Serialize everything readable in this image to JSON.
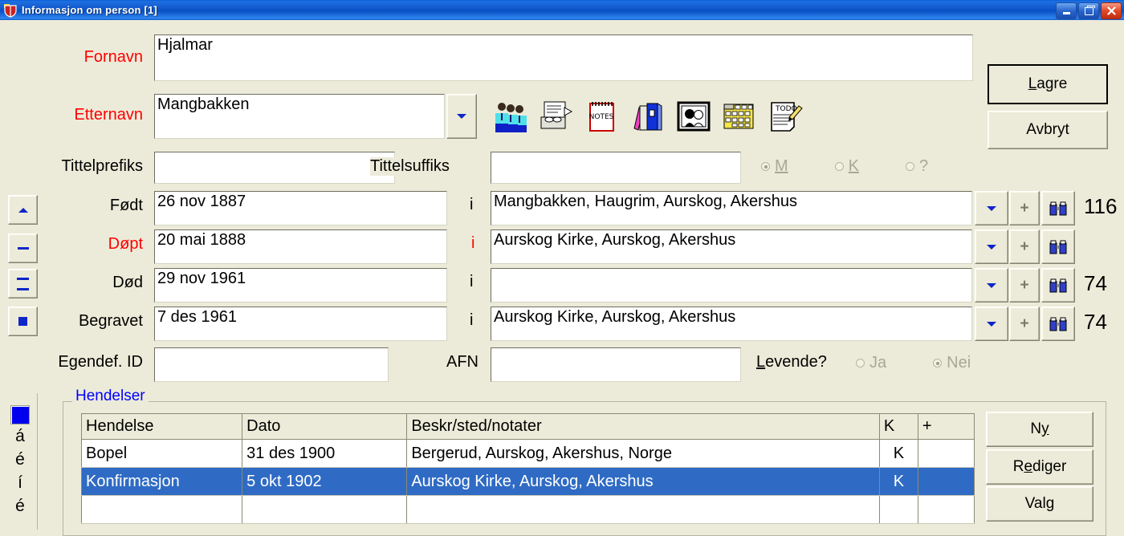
{
  "window": {
    "title": "Informasjon om person  [1]",
    "icon": "app-shield-icon",
    "minimize": "–",
    "restore": "❐",
    "close": "✕",
    "titlebar_color": "#0a4fc4",
    "background_color": "#ecebd9"
  },
  "form": {
    "fornavn": {
      "label": "Fornavn",
      "value": "Hjalmar",
      "label_color": "#ff0000"
    },
    "etternavn": {
      "label": "Etternavn",
      "value": "Mangbakken",
      "label_color": "#ff0000",
      "dropdown": "chevron-down-icon"
    },
    "tittelprefiks": {
      "label": "Tittelprefiks",
      "value": ""
    },
    "tittelsuffiks": {
      "label": "Tittelsuffiks",
      "value": ""
    },
    "egendef_id": {
      "label": "Egendef. ID",
      "value": ""
    },
    "afn": {
      "label": "AFN",
      "value": ""
    }
  },
  "gender": {
    "options": [
      {
        "label": "M",
        "accel": "M",
        "selected": true
      },
      {
        "label": "K",
        "accel": "K",
        "selected": false
      },
      {
        "label": "?",
        "accel": "",
        "selected": false
      }
    ],
    "disabled": true
  },
  "levende": {
    "label": "Levende?",
    "accel": "L",
    "options": [
      {
        "label": "Ja",
        "selected": false
      },
      {
        "label": "Nei",
        "selected": true
      }
    ],
    "disabled": true
  },
  "toolbar_icons": [
    "family-group-icon",
    "documents-icon",
    "notes-pad-icon",
    "books-icon",
    "photo-portrait-icon",
    "calendar-grid-icon",
    "todo-list-icon"
  ],
  "actions": {
    "save": {
      "label": "Lagre",
      "accel": "L",
      "default": true
    },
    "cancel": {
      "label": "Avbryt"
    }
  },
  "vital_side_buttons": [
    {
      "name": "move-up-button",
      "glyph": "▲"
    },
    {
      "name": "dash-button",
      "glyph": "–"
    },
    {
      "name": "equals-button",
      "glyph": "≡"
    },
    {
      "name": "square-button",
      "glyph": "■"
    }
  ],
  "vitals": [
    {
      "label": "Født",
      "label_color": "#000000",
      "date": "26 nov 1887",
      "info_mark": "i",
      "info_color": "#000000",
      "place": "Mangbakken, Haugrim, Aurskog, Akershus",
      "age": "116"
    },
    {
      "label": "Døpt",
      "label_color": "#ff0000",
      "date": "20 mai 1888",
      "info_mark": "i",
      "info_color": "#ff0000",
      "place": "Aurskog Kirke, Aurskog, Akershus",
      "age": ""
    },
    {
      "label": "Død",
      "label_color": "#000000",
      "date": "29 nov 1961",
      "info_mark": "i",
      "info_color": "#000000",
      "place": "",
      "age": "74"
    },
    {
      "label": "Begravet",
      "label_color": "#000000",
      "date": "7 des 1961",
      "info_mark": "i",
      "info_color": "#000000",
      "place": "Aurskog Kirke, Aurskog, Akershus",
      "age": "74"
    }
  ],
  "row_buttons": {
    "dropdown": "chevron-down-icon",
    "add": "+",
    "search": "binoculars-search-icon"
  },
  "events": {
    "group_title": "Hendelser",
    "columns": [
      "Hendelse",
      "Dato",
      "Beskr/sted/notater",
      "K",
      "+"
    ],
    "rows": [
      {
        "hendelse": "Bopel",
        "dato": "31 des 1900",
        "beskr": "Bergerud, Aurskog, Akershus, Norge",
        "k": "K",
        "plus": "",
        "selected": false
      },
      {
        "hendelse": "Konfirmasjon",
        "dato": "5 okt 1902",
        "beskr": "Aurskog Kirke, Aurskog, Akershus",
        "k": "K",
        "plus": "",
        "selected": true
      }
    ],
    "buttons": [
      {
        "label": "Ny",
        "accel": "y",
        "name": "new-event-button"
      },
      {
        "label": "Rediger",
        "accel": "e",
        "name": "edit-event-button"
      },
      {
        "label": "Valg",
        "accel": "g",
        "name": "options-event-button"
      }
    ],
    "selection_color": "#2f6bc4"
  },
  "accent_panel": {
    "swatch_color": "#0000ee",
    "chars": [
      "á",
      "é",
      "í",
      "é"
    ]
  }
}
